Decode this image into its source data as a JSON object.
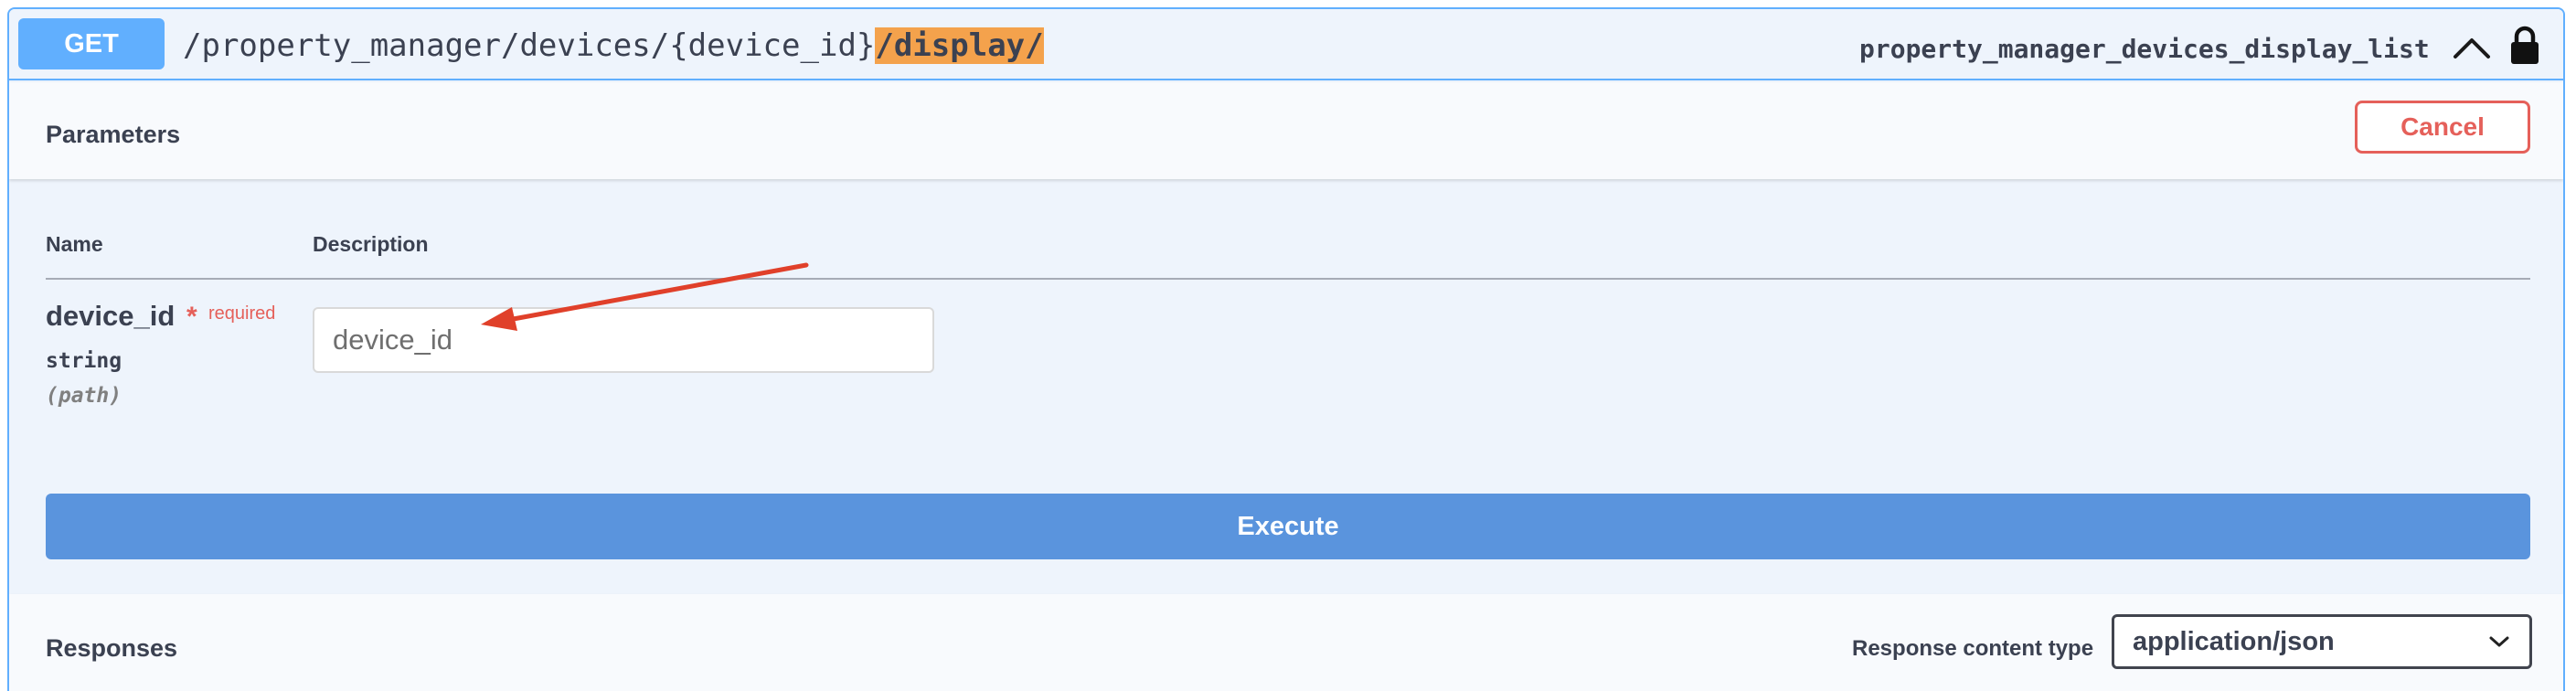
{
  "operation": {
    "method": "GET",
    "path_prefix": "/property_manager/devices/{device_id}",
    "path_highlight": "/display/",
    "operation_id": "property_manager_devices_display_list",
    "expanded": true,
    "locked": true
  },
  "parameters": {
    "title": "Parameters",
    "cancel_label": "Cancel",
    "columns": {
      "name": "Name",
      "description": "Description"
    },
    "items": [
      {
        "name": "device_id",
        "required_star": "*",
        "required_label": "required",
        "type": "string",
        "in": "(path)",
        "placeholder": "device_id",
        "value": ""
      }
    ]
  },
  "execute_label": "Execute",
  "responses": {
    "title": "Responses",
    "content_type_label": "Response content type",
    "content_type_value": "application/json"
  },
  "colors": {
    "method_get": "#61affe",
    "path_highlight": "#f4a24c",
    "cancel": "#e5605a",
    "execute": "#5a94dd",
    "annotation_arrow": "#e0402a"
  },
  "icons": [
    "chevron-up-icon",
    "lock-icon",
    "chevron-down-icon",
    "annotation-arrow"
  ]
}
